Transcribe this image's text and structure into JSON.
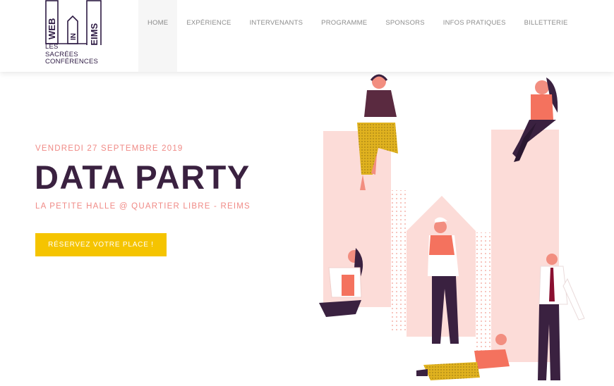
{
  "logo": {
    "word_top": "WEB",
    "word_mid": "IN",
    "word_right": "REIMS",
    "subtitle_lines": [
      "LES",
      "SACRÉES",
      "CONFÉRENCES"
    ]
  },
  "nav": {
    "items": [
      {
        "label": "HOME",
        "active": true
      },
      {
        "label": "EXPÉRIENCE",
        "active": false
      },
      {
        "label": "INTERVENANTS",
        "active": false
      },
      {
        "label": "PROGRAMME",
        "active": false
      },
      {
        "label": "SPONSORS",
        "active": false
      },
      {
        "label": "INFOS PRATIQUES",
        "active": false
      },
      {
        "label": "BILLETTERIE",
        "active": false
      }
    ]
  },
  "hero": {
    "date": "VENDREDI 27 SEPTEMBRE 2019",
    "title": "DATA PARTY",
    "venue": "LA PETITE HALLE @ QUARTIER LIBRE - REIMS",
    "cta_label": "RÉSERVEZ VOTRE PLACE !"
  },
  "colors": {
    "accent": "#f08a86",
    "title": "#3a2140",
    "cta": "#f5c400",
    "logo": "#2d1a43",
    "bar_pink": "#fcdcd8"
  }
}
